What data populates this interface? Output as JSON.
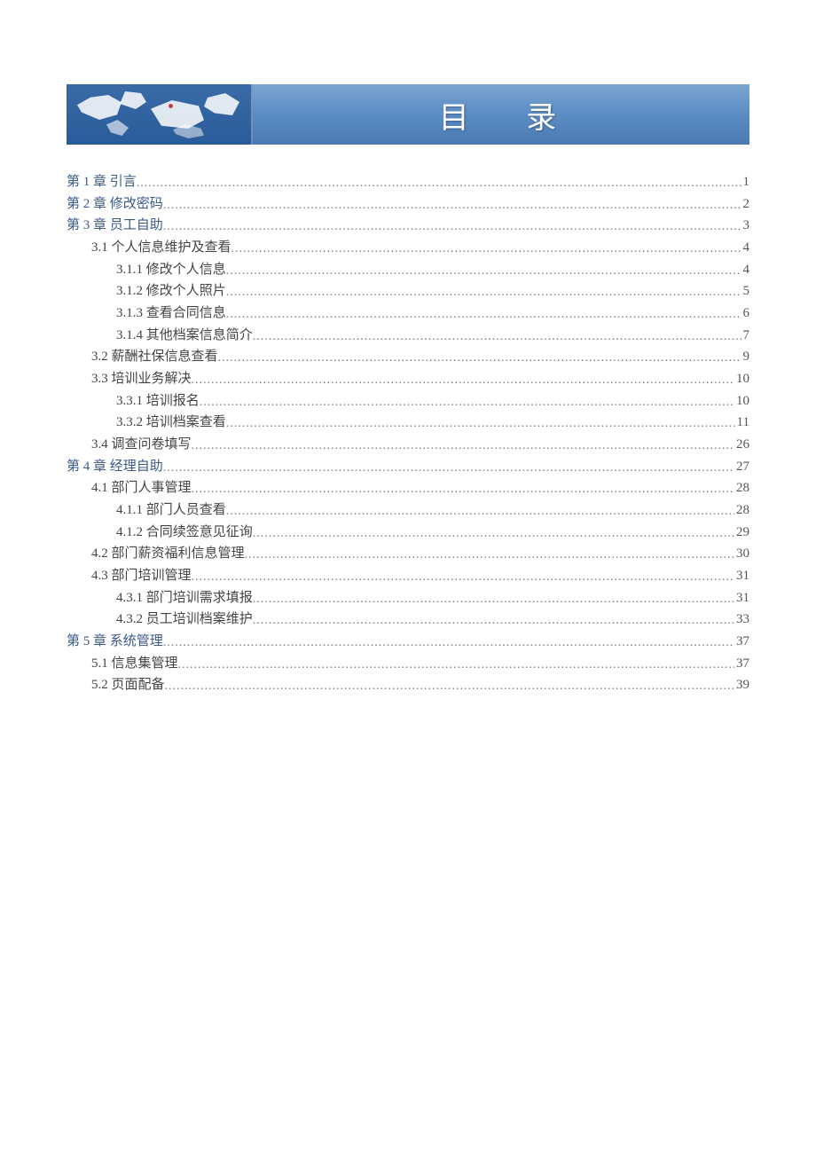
{
  "banner": {
    "title": "目 录"
  },
  "toc": [
    {
      "level": 0,
      "chapter": true,
      "label": "第 1 章  引言",
      "page": "1"
    },
    {
      "level": 0,
      "chapter": true,
      "label": "第 2 章  修改密码",
      "page": "2"
    },
    {
      "level": 0,
      "chapter": true,
      "label": "第 3 章  员工自助",
      "page": "3"
    },
    {
      "level": 1,
      "chapter": false,
      "label": "3.1 个人信息维护及查看",
      "page": "4"
    },
    {
      "level": 2,
      "chapter": false,
      "label": "3.1.1 修改个人信息",
      "page": "4"
    },
    {
      "level": 2,
      "chapter": false,
      "label": "3.1.2 修改个人照片",
      "page": "5"
    },
    {
      "level": 2,
      "chapter": false,
      "label": "3.1.3 查看合同信息",
      "page": "6"
    },
    {
      "level": 2,
      "chapter": false,
      "label": "3.1.4 其他档案信息简介",
      "page": "7"
    },
    {
      "level": 1,
      "chapter": false,
      "label": "3.2 薪酬社保信息查看",
      "page": "9"
    },
    {
      "level": 1,
      "chapter": false,
      "label": "3.3 培训业务解决",
      "page": "10"
    },
    {
      "level": 2,
      "chapter": false,
      "label": "3.3.1  培训报名 ",
      "page": "10"
    },
    {
      "level": 2,
      "chapter": false,
      "label": "3.3.2  培训档案查看 ",
      "page": "11"
    },
    {
      "level": 1,
      "chapter": false,
      "label": "3.4 调查问卷填写",
      "page": "26"
    },
    {
      "level": 0,
      "chapter": true,
      "label": "第 4 章  经理自助",
      "page": "27"
    },
    {
      "level": 1,
      "chapter": false,
      "label": "4.1 部门人事管理",
      "page": "28"
    },
    {
      "level": 2,
      "chapter": false,
      "label": "4.1.1 部门人员查看",
      "page": "28"
    },
    {
      "level": 2,
      "chapter": false,
      "label": "4.1.2 合同续签意见征询",
      "page": "29"
    },
    {
      "level": 1,
      "chapter": false,
      "label": "4.2 部门薪资福利信息管理",
      "page": "30"
    },
    {
      "level": 1,
      "chapter": false,
      "label": "4.3 部门培训管理",
      "page": "31"
    },
    {
      "level": 2,
      "chapter": false,
      "label": "4.3.1 部门培训需求填报",
      "page": "31"
    },
    {
      "level": 2,
      "chapter": false,
      "label": "4.3.2 员工培训档案维护",
      "page": "33"
    },
    {
      "level": 0,
      "chapter": true,
      "label": "第 5 章  系统管理",
      "page": "37"
    },
    {
      "level": 1,
      "chapter": false,
      "label": "5.1 信息集管理",
      "page": "37"
    },
    {
      "level": 1,
      "chapter": false,
      "label": "5.2 页面配备",
      "page": "39"
    }
  ]
}
